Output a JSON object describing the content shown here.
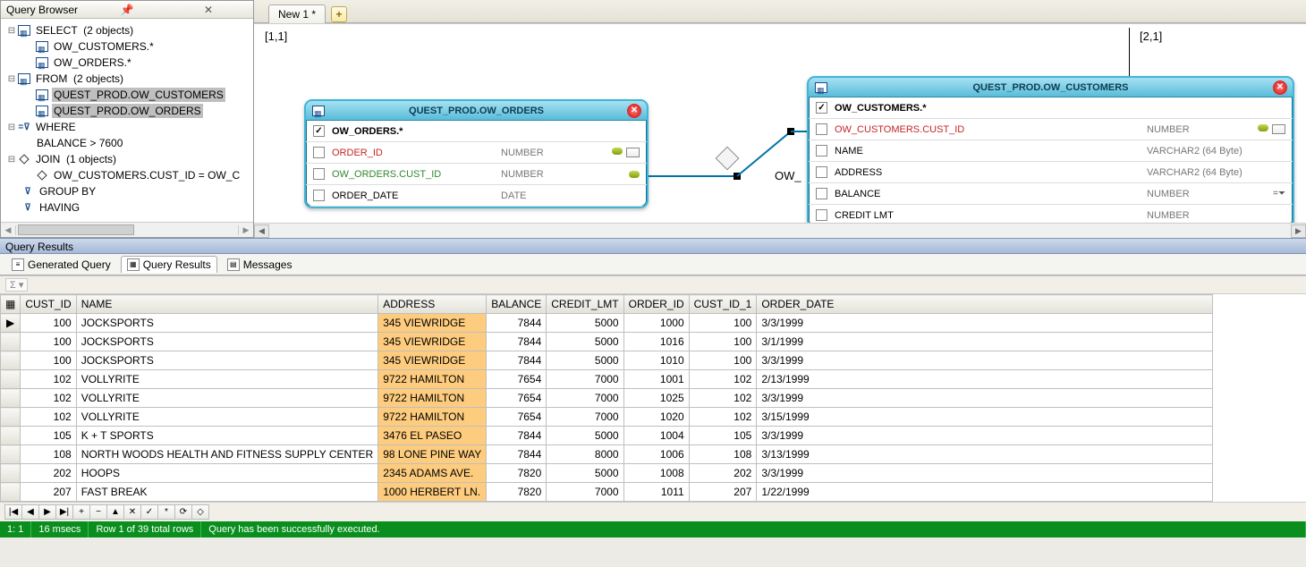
{
  "browser": {
    "title": "Query Browser",
    "tree": {
      "select": {
        "label": "SELECT",
        "count": "(2 objects)",
        "children": [
          "OW_CUSTOMERS.*",
          "OW_ORDERS.*"
        ]
      },
      "from": {
        "label": "FROM",
        "count": "(2 objects)",
        "children": [
          "QUEST_PROD.OW_CUSTOMERS",
          "QUEST_PROD.OW_ORDERS"
        ]
      },
      "where": {
        "label": "WHERE",
        "cond": "BALANCE > 7600"
      },
      "join": {
        "label": "JOIN",
        "count": "(1 objects)",
        "cond": "OW_CUSTOMERS.CUST_ID = OW_C"
      },
      "groupby": "GROUP BY",
      "having": "HAVING"
    }
  },
  "tabs": {
    "active": "New 1 *"
  },
  "canvas": {
    "cell1": "[1,1]",
    "cell2": "[2,1]",
    "owlabel": "OW_",
    "orders": {
      "title": "QUEST_PROD.OW_ORDERS",
      "rows": [
        {
          "chk": true,
          "name": "OW_ORDERS.*",
          "type": "",
          "bold": true
        },
        {
          "chk": false,
          "name": "ORDER_ID",
          "type": "NUMBER",
          "red": true,
          "key": true,
          "grid": true
        },
        {
          "chk": false,
          "name": "OW_ORDERS.CUST_ID",
          "type": "NUMBER",
          "green": true,
          "key": true
        },
        {
          "chk": false,
          "name": "ORDER_DATE",
          "type": "DATE"
        }
      ]
    },
    "customers": {
      "title": "QUEST_PROD.OW_CUSTOMERS",
      "rows": [
        {
          "chk": true,
          "name": "OW_CUSTOMERS.*",
          "type": "",
          "bold": true
        },
        {
          "chk": false,
          "name": "OW_CUSTOMERS.CUST_ID",
          "type": "NUMBER",
          "red": true,
          "key": true,
          "grid": true
        },
        {
          "chk": false,
          "name": "NAME",
          "type": "VARCHAR2 (64 Byte)"
        },
        {
          "chk": false,
          "name": "ADDRESS",
          "type": "VARCHAR2 (64 Byte)"
        },
        {
          "chk": false,
          "name": "BALANCE",
          "type": "NUMBER",
          "filter": true
        },
        {
          "chk": false,
          "name": "CREDIT LMT",
          "type": "NUMBER"
        }
      ]
    }
  },
  "results": {
    "header": "Query Results",
    "tabs": {
      "gq": "Generated Query",
      "qr": "Query Results",
      "msg": "Messages"
    },
    "sigma": "Σ",
    "cols": [
      "CUST_ID",
      "NAME",
      "ADDRESS",
      "BALANCE",
      "CREDIT_LMT",
      "ORDER_ID",
      "CUST_ID_1",
      "ORDER_DATE"
    ],
    "rows": [
      [
        "100",
        "JOCKSPORTS",
        "345 VIEWRIDGE",
        "7844",
        "5000",
        "1000",
        "100",
        "3/3/1999"
      ],
      [
        "100",
        "JOCKSPORTS",
        "345 VIEWRIDGE",
        "7844",
        "5000",
        "1016",
        "100",
        "3/1/1999"
      ],
      [
        "100",
        "JOCKSPORTS",
        "345 VIEWRIDGE",
        "7844",
        "5000",
        "1010",
        "100",
        "3/3/1999"
      ],
      [
        "102",
        "VOLLYRITE",
        "9722 HAMILTON",
        "7654",
        "7000",
        "1001",
        "102",
        "2/13/1999"
      ],
      [
        "102",
        "VOLLYRITE",
        "9722 HAMILTON",
        "7654",
        "7000",
        "1025",
        "102",
        "3/3/1999"
      ],
      [
        "102",
        "VOLLYRITE",
        "9722 HAMILTON",
        "7654",
        "7000",
        "1020",
        "102",
        "3/15/1999"
      ],
      [
        "105",
        "K + T SPORTS",
        "3476 EL PASEO",
        "7844",
        "5000",
        "1004",
        "105",
        "3/3/1999"
      ],
      [
        "108",
        "NORTH WOODS HEALTH AND FITNESS SUPPLY CENTER",
        "98 LONE PINE WAY",
        "7844",
        "8000",
        "1006",
        "108",
        "3/13/1999"
      ],
      [
        "202",
        "HOOPS",
        "2345 ADAMS AVE.",
        "7820",
        "5000",
        "1008",
        "202",
        "3/3/1999"
      ],
      [
        "207",
        "FAST BREAK",
        "1000 HERBERT LN.",
        "7820",
        "7000",
        "1011",
        "207",
        "1/22/1999"
      ]
    ],
    "hlcol": 2
  },
  "navbtns": [
    "|◀",
    "◀",
    "▶",
    "▶|",
    "+",
    "−",
    "▲",
    "✕",
    "✓",
    "*",
    "⟳",
    "◇"
  ],
  "status": {
    "pos": "1:   1",
    "time": "16 msecs",
    "row": "Row 1 of 39 total rows",
    "msg": "Query has been successfully executed."
  }
}
